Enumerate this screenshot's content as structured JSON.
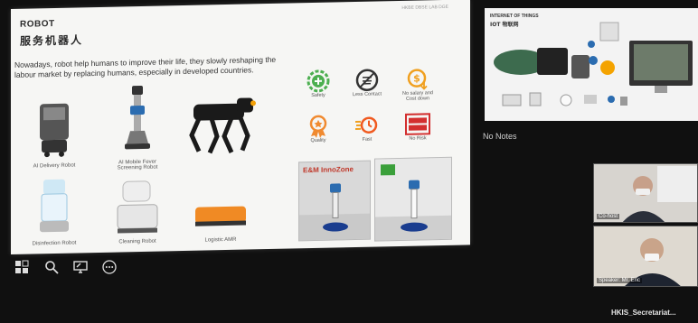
{
  "slide": {
    "title": "ROBOT",
    "subtitle": "服务机器人",
    "header_right": "HKBE DBSE LAB DGE",
    "intro": "Nowadays, robot help humans to improve their life, they slowly reshaping the labour market by replacing humans, especially in developed countries.",
    "robots": [
      {
        "label": "AI Delivery Robot"
      },
      {
        "label": "AI Mobile Fever Screening Robot"
      },
      {
        "label": "Disinfection Robot"
      },
      {
        "label": "Cleaning Robot"
      },
      {
        "label": "Logistic AMR"
      }
    ],
    "features": [
      {
        "label": "Safety",
        "icon": "plus-gear-icon",
        "color": "#4caf50"
      },
      {
        "label": "Less Contact",
        "icon": "no-contact-icon",
        "color": "#333333"
      },
      {
        "label": "No salary and Cost down",
        "icon": "dollar-down-icon",
        "color": "#f0a020"
      },
      {
        "label": "Quality",
        "icon": "medal-icon",
        "color": "#f08a30"
      },
      {
        "label": "Fast",
        "icon": "fast-icon",
        "color": "#f05a20"
      },
      {
        "label": "No Risk",
        "icon": "risk-free-stamp",
        "color": "#d32f2f"
      }
    ],
    "photos": [
      {
        "label": "E&M InnoZone"
      },
      {
        "label": ""
      }
    ]
  },
  "toolbar": [
    {
      "icon": "slides-grid-icon"
    },
    {
      "icon": "search-icon"
    },
    {
      "icon": "screen-share-icon"
    },
    {
      "icon": "more-options-icon"
    }
  ],
  "next_slide": {
    "title": "INTERNET OF THINGS",
    "subtitle": "IOT 物联网"
  },
  "notes": "No Notes",
  "participants": [
    {
      "name": "Co-host"
    },
    {
      "name": "Speaker: Mr. Eric"
    }
  ],
  "meeting_name": "HKIS_Secretariat..."
}
